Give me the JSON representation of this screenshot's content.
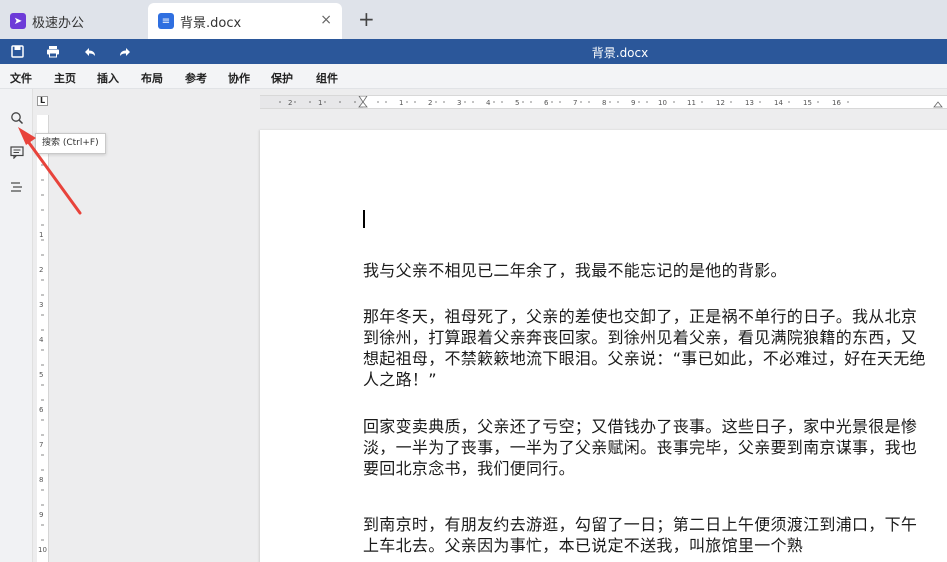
{
  "tabs": {
    "app_label": "极速办公",
    "doc_label": "背景.docx",
    "close_glyph": "×",
    "new_tab_glyph": "+"
  },
  "titlebar": {
    "doc_title": "背景.docx",
    "icons": [
      "save-icon",
      "print-icon",
      "undo-icon",
      "redo-icon"
    ]
  },
  "menu": {
    "items": [
      "文件",
      "主页",
      "插入",
      "布局",
      "参考",
      "协作",
      "保护",
      "组件"
    ]
  },
  "rail": {
    "icons": [
      "search-icon",
      "comment-icon",
      "outline-icon"
    ],
    "search_tooltip": "搜索 (Ctrl+F)"
  },
  "ruler": {
    "corner": "L"
  },
  "document": {
    "paragraphs": [
      "我与父亲不相见已二年余了，我最不能忘记的是他的背影。",
      "那年冬天，祖母死了，父亲的差使也交卸了，正是祸不单行的日子。我从北京到徐州，打算跟着父亲奔丧回家。到徐州见着父亲，看见满院狼籍的东西，又想起祖母，不禁簌簌地流下眼泪。父亲说：“事已如此，不必难过，好在天无绝人之路！”",
      "回家变卖典质，父亲还了亏空；又借钱办了丧事。这些日子，家中光景很是惨淡，一半为了丧事，一半为了父亲赋闲。丧事完毕，父亲要到南京谋事，我也要回北京念书，我们便同行。",
      "到南京时，有朋友约去游逛，勾留了一日；第二日上午便须渡江到浦口，下午上车北去。父亲因为事忙，本已说定不送我，叫旅馆里一个熟"
    ]
  },
  "colors": {
    "titlebar": "#2b579a",
    "annotation_arrow": "#e8433b"
  }
}
